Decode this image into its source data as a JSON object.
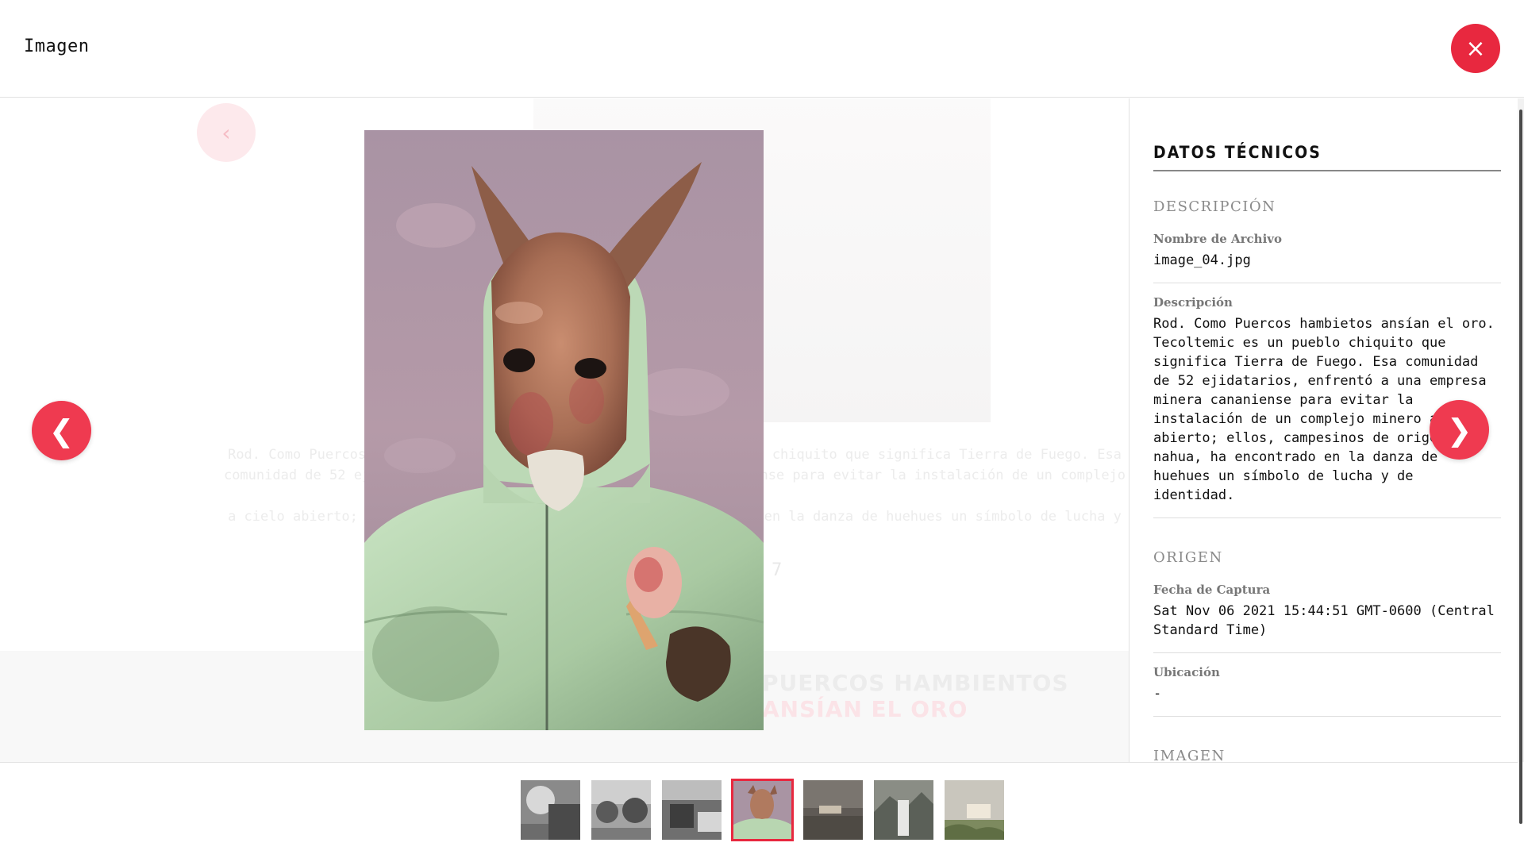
{
  "header": {
    "title": "Imagen",
    "close_icon": "close-icon",
    "close_symbol": "×"
  },
  "navigation": {
    "prev_symbol": "❮",
    "next_symbol": "❯",
    "ghost_prev_symbol": "‹"
  },
  "background_page": {
    "text_lines": [
      "Rod. Como Puercos hambietos ansían el oro. Tecoltemic es un pueblo chiquito que significa Tierra de Fuego. Esa",
      "comunidad de 52 ejidatarios, enfrentó a una empresa minera cananiense para evitar la instalación de un complejo minero",
      "a cielo abierto; ellos, campesinos de origen nahua, ha encontrado en la danza de huehues un símbolo de lucha y de identidad."
    ],
    "band_title_plain": "PUERCOS HAMBIENTOS",
    "band_title_accent": "ANSÍAN EL ORO",
    "page_number": "7"
  },
  "panel": {
    "title": "DATOS TÉCNICOS",
    "sections": {
      "descripcion": {
        "heading": "DESCRIPCIÓN",
        "file_name_label": "Nombre de Archivo",
        "file_name_value": "image_04.jpg",
        "description_label": "Descripción",
        "description_value": "Rod. Como Puercos hambietos ansían el oro. Tecoltemic es un pueblo chiquito que significa Tierra de Fuego. Esa comunidad de 52 ejidatarios, enfrentó a una empresa minera cananiense para evitar la instalación de un complejo minero a cielo abierto; ellos, campesinos de origen nahua, ha encontrado en la danza de huehues un símbolo de lucha y de identidad."
      },
      "origen": {
        "heading": "ORIGEN",
        "capture_date_label": "Fecha de Captura",
        "capture_date_value": "Sat Nov 06 2021 15:44:51 GMT-0600 (Central Standard Time)",
        "location_label": "Ubicación",
        "location_value": "-"
      },
      "imagen": {
        "heading": "IMAGEN"
      }
    }
  },
  "thumbnails": {
    "active_index": 3,
    "items": [
      "image_01",
      "image_02",
      "image_03",
      "image_04",
      "image_05",
      "image_06",
      "image_07"
    ]
  },
  "colors": {
    "accent": "#e8283f",
    "nav": "#ef3a50"
  }
}
